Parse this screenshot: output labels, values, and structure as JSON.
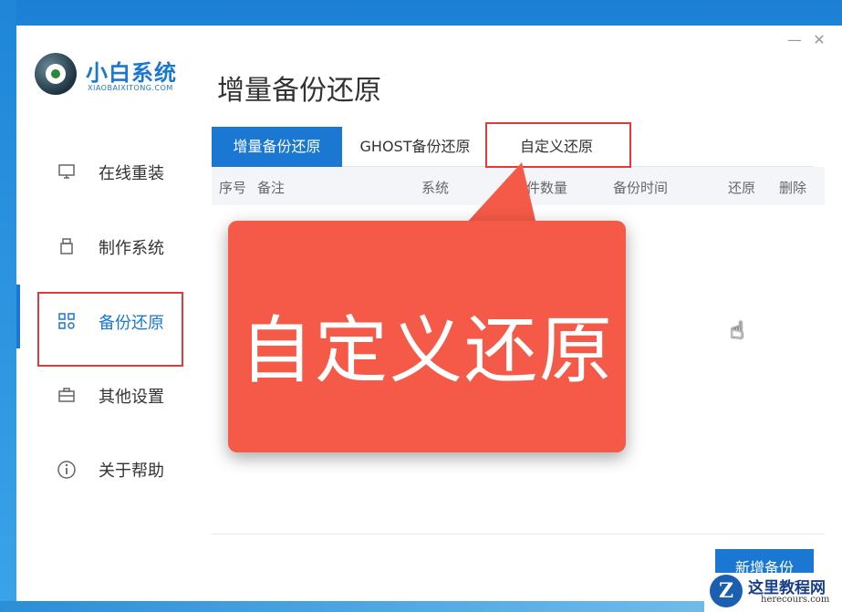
{
  "app": {
    "logo_title": "小白系统",
    "logo_subtitle": "XIAOBAIXITONG.COM",
    "window_controls": {
      "minimize": "—",
      "close": "✕"
    }
  },
  "sidebar": {
    "items": [
      {
        "label": "在线重装",
        "icon": "monitor-icon",
        "active": false
      },
      {
        "label": "制作系统",
        "icon": "usb-icon",
        "active": false
      },
      {
        "label": "备份还原",
        "icon": "backup-grid-icon",
        "active": true
      },
      {
        "label": "其他设置",
        "icon": "briefcase-icon",
        "active": false
      },
      {
        "label": "关于帮助",
        "icon": "info-icon",
        "active": false
      }
    ]
  },
  "main": {
    "title": "增量备份还原",
    "tabs": [
      {
        "label": "增量备份还原",
        "active": true
      },
      {
        "label": "GHOST备份还原",
        "active": false
      },
      {
        "label": "自定义还原",
        "active": false
      }
    ],
    "table_headers": [
      "序号",
      "备注",
      "系统",
      "文件数量",
      "备份时间",
      "还原",
      "删除"
    ],
    "add_button": "新增备份"
  },
  "overlay": {
    "callout_text": "自定义还原",
    "highlight_color": "#e03a3a",
    "callout_color": "#f45a47"
  },
  "watermark": {
    "title": "这里教程网",
    "url": "herecours.com",
    "mark": "Z"
  },
  "colors": {
    "accent": "#1a78d2"
  }
}
